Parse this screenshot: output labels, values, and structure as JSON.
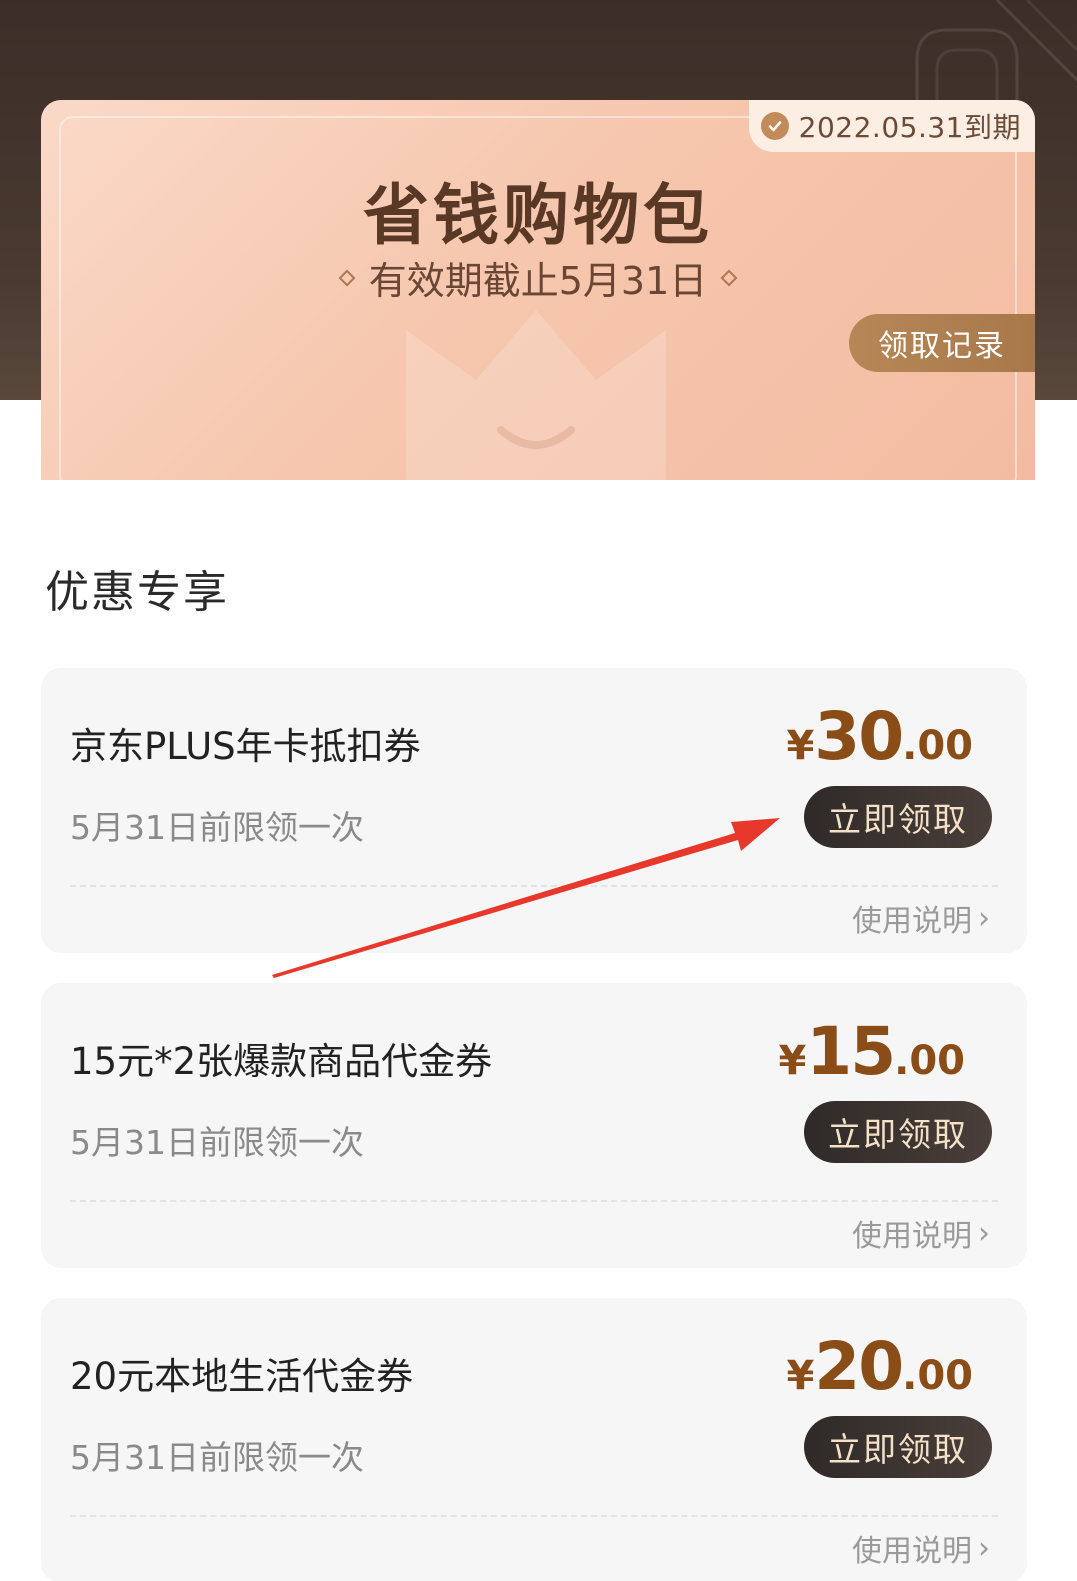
{
  "header": {
    "expiry_text": "2022.05.31到期",
    "title": "省钱购物包",
    "subtitle": "有效期截止5月31日",
    "record_button": "领取记录"
  },
  "section": {
    "title": "优惠专享"
  },
  "coupons": [
    {
      "name": "京东PLUS年卡抵扣券",
      "limit": "5月31日前限领一次",
      "currency": "¥",
      "price_int": "30",
      "price_dec": ".00",
      "claim_button": "立即领取",
      "help_link": "使用说明"
    },
    {
      "name": "15元*2张爆款商品代金券",
      "limit": "5月31日前限领一次",
      "currency": "¥",
      "price_int": "15",
      "price_dec": ".00",
      "claim_button": "立即领取",
      "help_link": "使用说明"
    },
    {
      "name": "20元本地生活代金券",
      "limit": "5月31日前限领一次",
      "currency": "¥",
      "price_int": "20",
      "price_dec": ".00",
      "claim_button": "立即领取",
      "help_link": "使用说明"
    }
  ],
  "colors": {
    "header_dark": "#3b2e28",
    "card_peach": "#f6c7ae",
    "price_brown": "#8b4d17",
    "button_dark": "#2f2a28",
    "annotation_red": "#e8382c"
  },
  "icons": {
    "expiry": "check-circle-icon",
    "help": "chevron-right-icon"
  }
}
